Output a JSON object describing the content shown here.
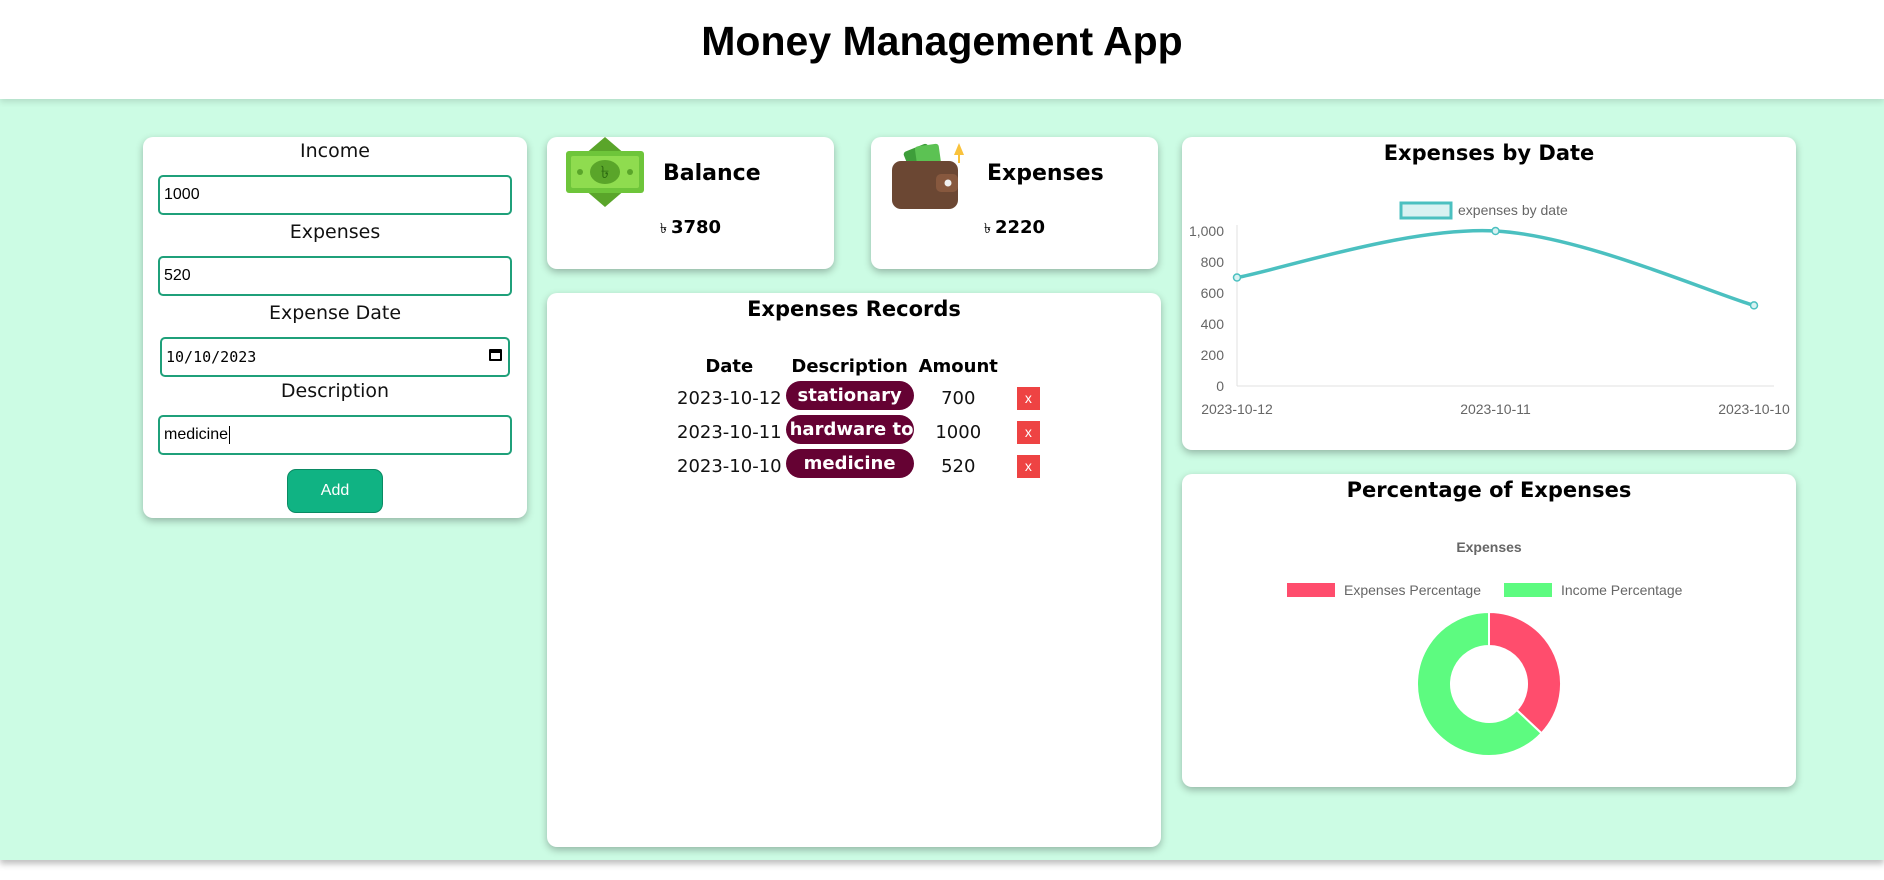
{
  "app": {
    "title": "Money Management App"
  },
  "form": {
    "income_label": "Income",
    "income_value": "1000",
    "expenses_label": "Expenses",
    "expenses_value": "520",
    "date_label": "Expense Date",
    "date_value": "10/10/2023",
    "description_label": "Description",
    "description_value": "medicine",
    "add_label": "Add"
  },
  "balance": {
    "title": "Balance",
    "currency": "৳",
    "amount": "3780",
    "icon": "cash-icon"
  },
  "expenses_summary": {
    "title": "Expenses",
    "currency": "৳",
    "amount": "2220",
    "icon": "wallet-icon"
  },
  "records": {
    "title": "Expenses Records",
    "columns": [
      "Date",
      "Description",
      "Amount"
    ],
    "rows": [
      {
        "date": "2023-10-12",
        "description": "stationary",
        "amount": "700",
        "delete_label": "x"
      },
      {
        "date": "2023-10-11",
        "description": "hardware tool",
        "amount": "1000",
        "delete_label": "x"
      },
      {
        "date": "2023-10-10",
        "description": "medicine",
        "amount": "520",
        "delete_label": "x"
      }
    ]
  },
  "colors": {
    "page_bg": "#ccfce4",
    "accent_green": "#10b383",
    "pill": "#650233",
    "delete": "#ee4343",
    "line": "#4bc0c0",
    "expenses_slice": "#ff4d6d",
    "income_slice": "#5dfb80"
  },
  "line_chart": {
    "title": "Expenses by Date",
    "chart_data": {
      "type": "line",
      "categories": [
        "2023-10-12",
        "2023-10-11",
        "2023-10-10"
      ],
      "series": [
        {
          "name": "expenses by date",
          "values": [
            700,
            1000,
            520
          ]
        }
      ],
      "ylim": [
        0,
        1000
      ],
      "yticks": [
        0,
        200,
        400,
        600,
        800,
        1000
      ],
      "ytick_labels": [
        "0",
        "200",
        "400",
        "600",
        "800",
        "1,000"
      ],
      "legend": "top",
      "grid": false
    }
  },
  "donut_chart": {
    "title": "Percentage of Expenses",
    "chart_data": {
      "type": "pie",
      "title": "Expenses",
      "categories": [
        "Expenses Percentage",
        "Income Percentage"
      ],
      "values": [
        37,
        63
      ],
      "legend": "top"
    }
  }
}
